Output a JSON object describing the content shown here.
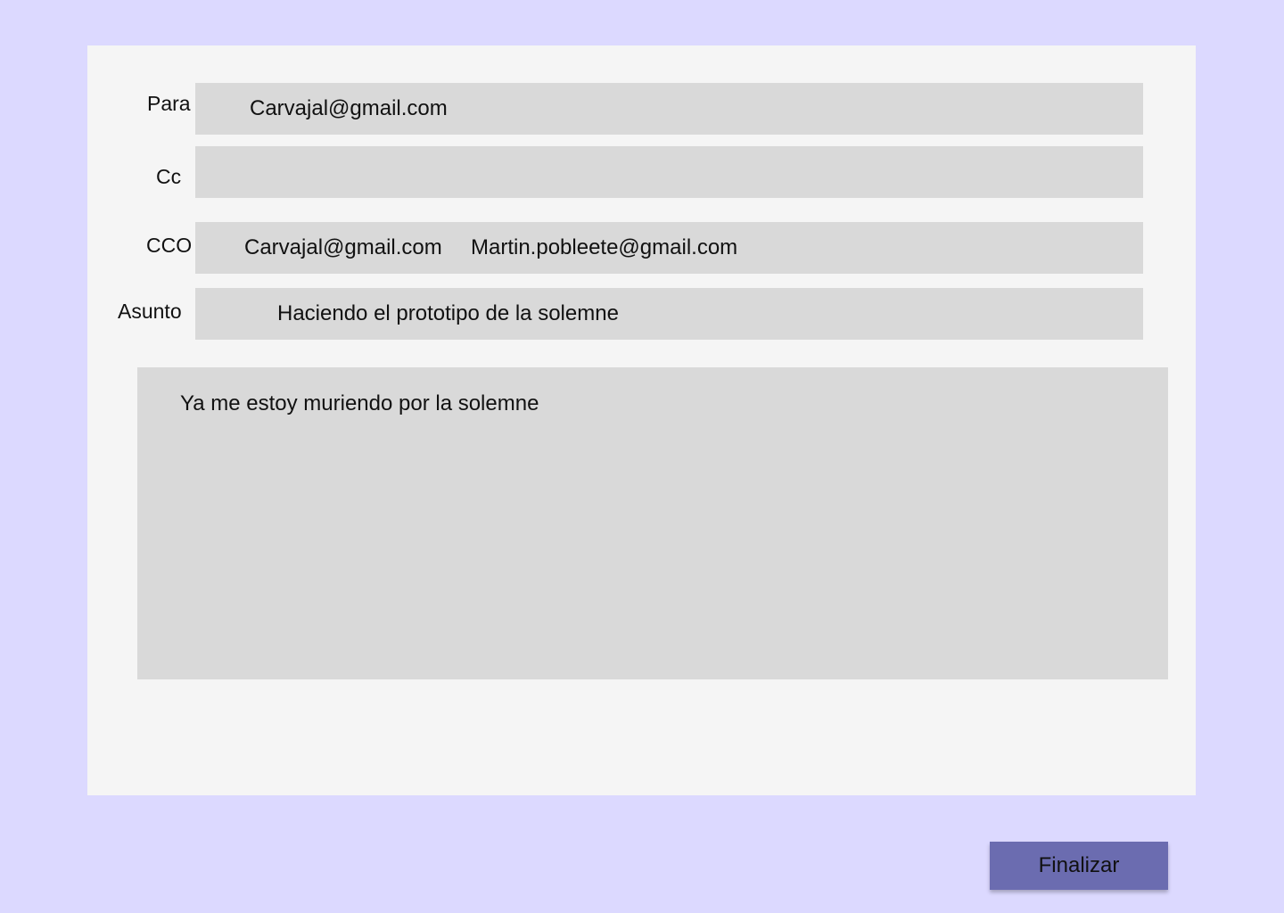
{
  "colors": {
    "background": "#dcd9ff",
    "panel": "#f5f5f5",
    "field": "#d9d9d9",
    "button": "#6b6cb0"
  },
  "form": {
    "to": {
      "label": "Para",
      "value": "Carvajal@gmail.com"
    },
    "cc": {
      "label": "Cc",
      "value": ""
    },
    "bcc": {
      "label": "CCO",
      "recipients": [
        "Carvajal@gmail.com",
        "Martin.pobleete@gmail.com"
      ]
    },
    "subject": {
      "label": "Asunto",
      "value": "Haciendo el prototipo de la solemne"
    },
    "body": {
      "value": "Ya me estoy muriendo por la solemne"
    }
  },
  "actions": {
    "finalize_label": "Finalizar"
  }
}
